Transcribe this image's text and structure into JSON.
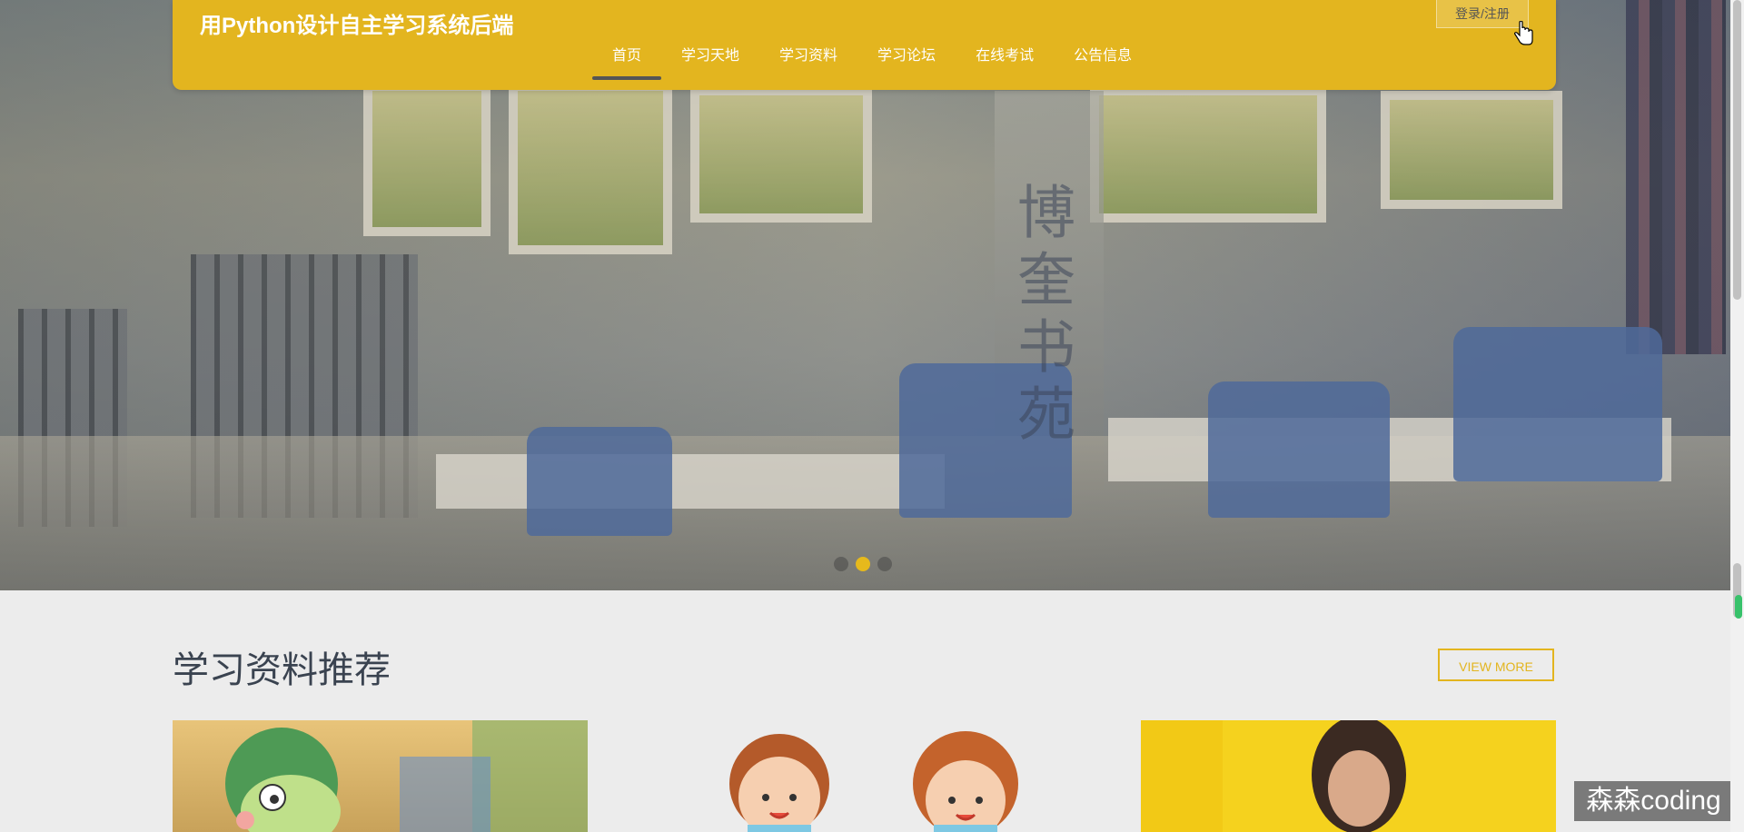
{
  "header": {
    "site_title": "用Python设计自主学习系统后端",
    "login_label": "登录/注册"
  },
  "nav": {
    "items": [
      {
        "label": "首页",
        "active": true
      },
      {
        "label": "学习天地",
        "active": false
      },
      {
        "label": "学习资料",
        "active": false
      },
      {
        "label": "学习论坛",
        "active": false
      },
      {
        "label": "在线考试",
        "active": false
      },
      {
        "label": "公告信息",
        "active": false
      }
    ]
  },
  "hero": {
    "slide_count": 3,
    "active_slide": 2,
    "sign_text": "博奎书苑"
  },
  "section": {
    "title": "学习资料推荐",
    "view_more_label": "VIEW MORE"
  },
  "watermark": "森森coding",
  "colors": {
    "accent": "#e3b51f",
    "nav_underline": "#555555",
    "page_bg": "#ececec",
    "scroll_indicator": "#38c26b"
  },
  "icons": [
    "mouse-pointer-icon",
    "carousel-dot"
  ]
}
